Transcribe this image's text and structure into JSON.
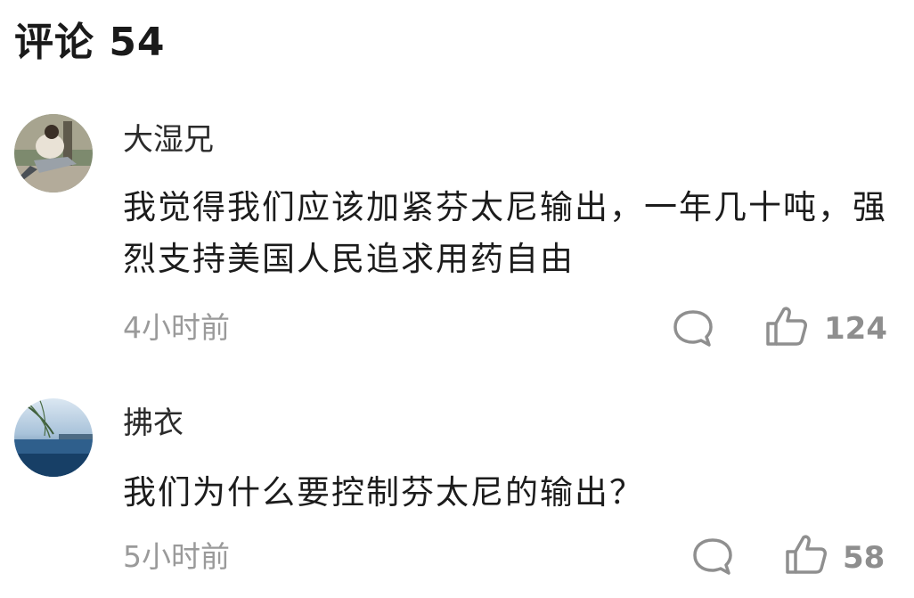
{
  "header": {
    "title": "评论 54"
  },
  "comments": [
    {
      "author": "大湿兄",
      "content": "我觉得我们应该加紧芬太尼输出，一年几十吨，强烈支持美国人民追求用药自由",
      "time": "4小时前",
      "likes": "124",
      "avatar_icon": "person-photo-avatar",
      "reply_icon": "comment-bubble-icon",
      "like_icon": "thumbs-up-icon"
    },
    {
      "author": "拂衣",
      "content": "我们为什么要控制芬太尼的输出？",
      "time": "5小时前",
      "likes": "58",
      "avatar_icon": "lake-landscape-avatar",
      "reply_icon": "comment-bubble-icon",
      "like_icon": "thumbs-up-icon"
    }
  ]
}
